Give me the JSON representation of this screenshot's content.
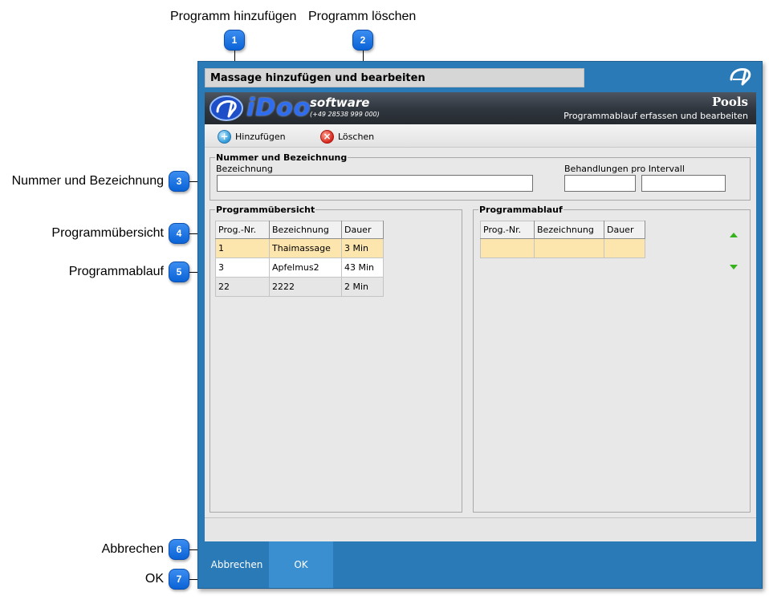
{
  "annotations": {
    "top": [
      {
        "number": "1",
        "label": "Programm hinzufügen"
      },
      {
        "number": "2",
        "label": "Programm löschen"
      }
    ],
    "left": [
      {
        "number": "3",
        "label": "Nummer und Bezeichnung"
      },
      {
        "number": "4",
        "label": "Programmübersicht"
      },
      {
        "number": "5",
        "label": "Programmablauf"
      },
      {
        "number": "6",
        "label": "Abbrechen"
      },
      {
        "number": "7",
        "label": "OK"
      }
    ]
  },
  "window": {
    "title": "Massage hinzufügen und bearbeiten",
    "corner_logo_icon": "idoo-logo-icon"
  },
  "banner": {
    "brand": "iDoo",
    "brand_sub": "software",
    "phone": "(+49 28538 999 000)",
    "title": "Pools",
    "subtitle": "Programmablauf erfassen und bearbeiten"
  },
  "toolbar": {
    "add_label": "Hinzufügen",
    "add_icon": "plus-circle-icon",
    "delete_label": "Löschen",
    "delete_icon": "x-circle-icon"
  },
  "nummer_group": {
    "legend": "Nummer und Bezeichnung",
    "bezeichnung_label": "Bezeichnung",
    "bezeichnung_value": "",
    "behandlungen_label": "Behandlungen pro Intervall",
    "behandlungen_value_1": "",
    "behandlungen_value_2": ""
  },
  "uebersicht": {
    "legend": "Programmübersicht",
    "columns": [
      "Prog.-Nr.",
      "Bezeichnung",
      "Dauer"
    ],
    "rows": [
      {
        "nr": "1",
        "bezeichnung": "Thaimassage",
        "dauer": "3 Min",
        "selected": true
      },
      {
        "nr": "3",
        "bezeichnung": "Apfelmus2",
        "dauer": "43 Min",
        "selected": false
      },
      {
        "nr": "22",
        "bezeichnung": "2222",
        "dauer": "2 Min",
        "selected": false
      }
    ]
  },
  "ablauf": {
    "legend": "Programmablauf",
    "columns": [
      "Prog.-Nr.",
      "Bezeichnung",
      "Dauer"
    ],
    "rows": [
      {
        "nr": "",
        "bezeichnung": "",
        "dauer": "",
        "selected": true
      }
    ],
    "move_up_icon": "arrow-up-icon",
    "move_down_icon": "arrow-down-icon"
  },
  "footer": {
    "cancel_label": "Abbrechen",
    "ok_label": "OK"
  },
  "colors": {
    "window_frame": "#2a7ab8",
    "selected_row": "#fde6ad",
    "badge": "#0b63d6",
    "ok_button": "#3a8fd0",
    "arrows": "#35b11c"
  }
}
